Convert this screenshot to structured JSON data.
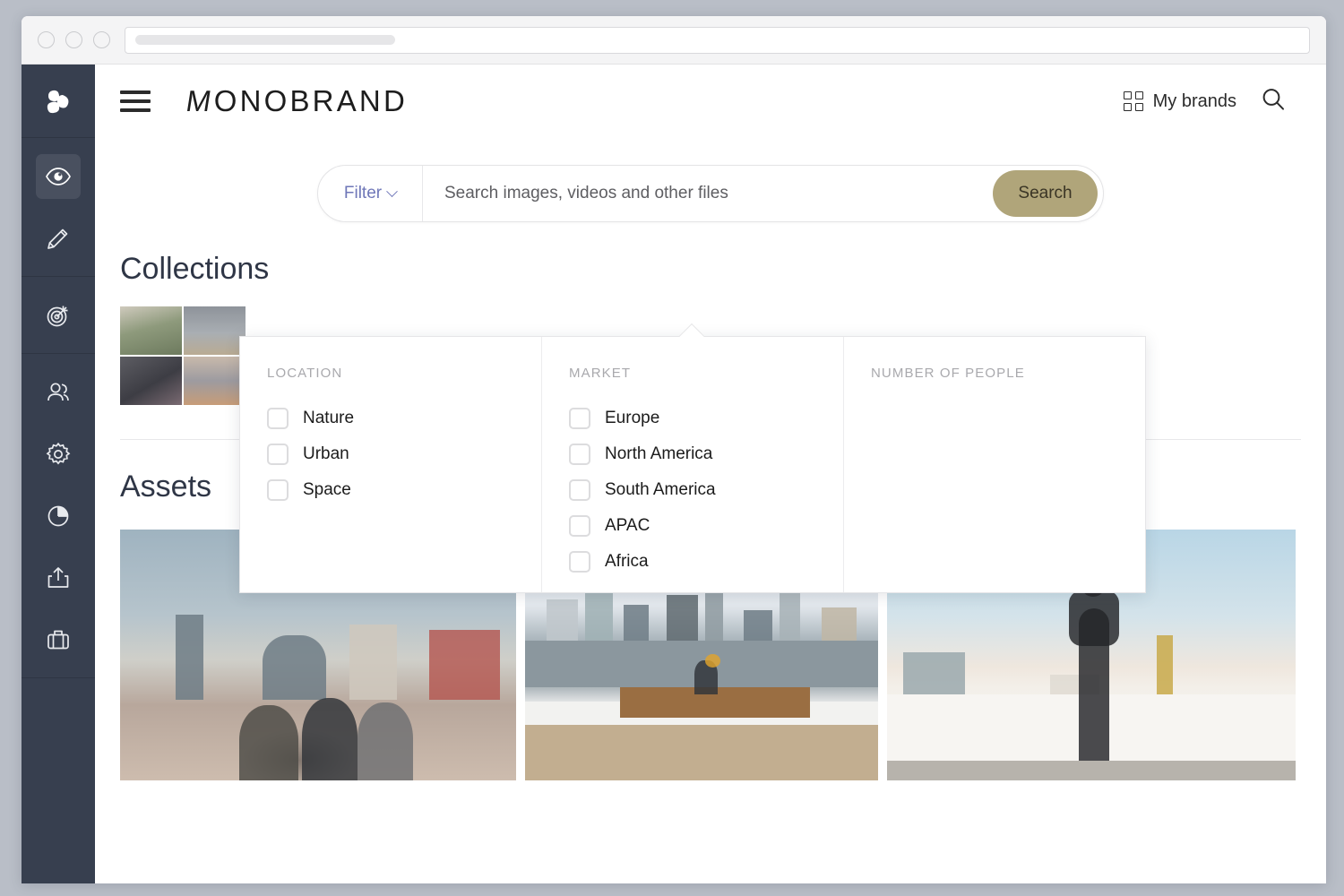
{
  "browser": {
    "traffic_lights": [
      "close",
      "minimize",
      "maximize"
    ],
    "url_value": "",
    "url_placeholder": ""
  },
  "sidebar": {
    "logo_name": "monobrand-logo",
    "groups": [
      {
        "items": [
          {
            "icon": "eye-icon",
            "name": "sidebar-item-view",
            "active": true
          },
          {
            "icon": "pencil-icon",
            "name": "sidebar-item-edit",
            "active": false
          }
        ]
      },
      {
        "items": [
          {
            "icon": "target-icon",
            "name": "sidebar-item-campaigns",
            "active": false
          }
        ]
      },
      {
        "items": [
          {
            "icon": "users-icon",
            "name": "sidebar-item-users",
            "active": false
          },
          {
            "icon": "gear-icon",
            "name": "sidebar-item-settings",
            "active": false
          },
          {
            "icon": "pie-chart-icon",
            "name": "sidebar-item-analytics",
            "active": false
          },
          {
            "icon": "upload-icon",
            "name": "sidebar-item-share",
            "active": false
          },
          {
            "icon": "briefcase-icon",
            "name": "sidebar-item-portfolio",
            "active": false
          }
        ]
      }
    ]
  },
  "header": {
    "menu_icon": "hamburger-icon",
    "brand_initial": "M",
    "brand_rest": "ONOBRAND",
    "my_brands_label": "My brands",
    "grid_icon": "grid-icon",
    "search_icon": "search-icon"
  },
  "search": {
    "filter_label": "Filter",
    "chevron_icon": "chevron-down-icon",
    "placeholder": "Search images, videos and other files",
    "value": "",
    "button_label": "Search",
    "button_color": "#b0a57a"
  },
  "filter_dropdown": {
    "columns": [
      {
        "title": "LOCATION",
        "options": [
          {
            "label": "Nature",
            "checked": false
          },
          {
            "label": "Urban",
            "checked": false
          },
          {
            "label": "Space",
            "checked": false
          }
        ]
      },
      {
        "title": "MARKET",
        "options": [
          {
            "label": "Europe",
            "checked": false
          },
          {
            "label": "North America",
            "checked": false
          },
          {
            "label": "South America",
            "checked": false
          },
          {
            "label": "APAC",
            "checked": false
          },
          {
            "label": "Africa",
            "checked": false
          }
        ]
      },
      {
        "title": "NUMBER OF PEOPLE",
        "options": []
      }
    ]
  },
  "collections": {
    "title": "Collections",
    "thumbnails": [
      {
        "alt": "person-with-backpack-walking"
      },
      {
        "alt": "couple-standing-on-shore"
      },
      {
        "alt": "woman-sitting-on-steps"
      },
      {
        "alt": "person-on-rooftop-overlooking-city"
      }
    ]
  },
  "assets": {
    "title": "Assets",
    "items": [
      {
        "alt": "people-sitting-in-city-plaza"
      },
      {
        "alt": "person-on-bench-facing-city-skyline"
      },
      {
        "alt": "person-leaning-on-rooftop-wall"
      }
    ]
  },
  "colors": {
    "sidebar_bg": "#373f4f",
    "accent_button": "#b0a57a",
    "filter_link": "#6f77b8",
    "heading": "#2f3646"
  }
}
